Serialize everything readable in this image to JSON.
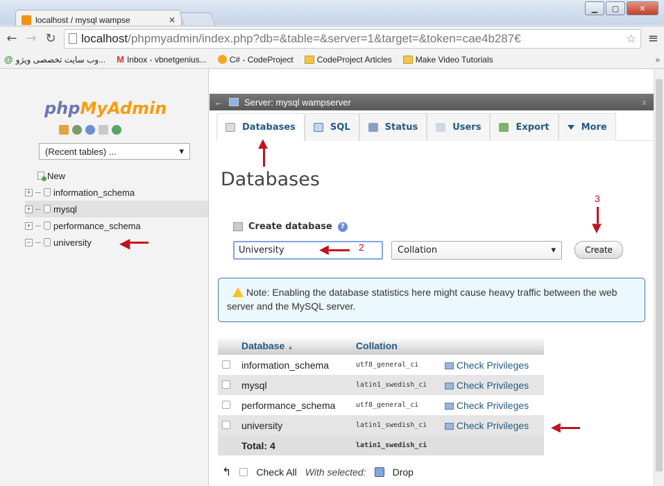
{
  "browser": {
    "tab_title": "localhost / mysql wampse",
    "tab_close": "✕",
    "url_host": "localhost",
    "url_path": "/phpmyadmin/index.php?db=&table=&server=1&target=&token=cae4b287€",
    "bookmarks": [
      {
        "label": "وب سایت تخصصی ویژو...",
        "icon": "ie-icon"
      },
      {
        "label": "Inbox - vbnetgenius...",
        "icon": "gmail-icon"
      },
      {
        "label": "C# - CodeProject",
        "icon": "codeproject-icon"
      },
      {
        "label": "CodeProject Articles",
        "icon": "folder-icon"
      },
      {
        "label": "Make Video Tutorials",
        "icon": "folder-icon"
      }
    ],
    "bookmarks_more": "»"
  },
  "nav": {
    "logo_php": "php",
    "logo_myadmin": "MyAdmin",
    "recent_tables": "(Recent tables) ...",
    "tree": [
      {
        "label": "New",
        "type": "new"
      },
      {
        "label": "information_schema",
        "type": "db"
      },
      {
        "label": "mysql",
        "type": "db"
      },
      {
        "label": "performance_schema",
        "type": "db"
      },
      {
        "label": "university",
        "type": "db"
      }
    ]
  },
  "main": {
    "server_title": "Server: mysql wampserver",
    "tabs": [
      {
        "label": "Databases"
      },
      {
        "label": "SQL"
      },
      {
        "label": "Status"
      },
      {
        "label": "Users"
      },
      {
        "label": "Export"
      },
      {
        "label": "More"
      }
    ],
    "page_title": "Databases",
    "create_label": "Create database",
    "db_name_value": "University",
    "collation_placeholder": "Collation",
    "create_button": "Create",
    "notice": "Note: Enabling the database statistics here might cause heavy traffic between the web server and the MySQL server.",
    "table": {
      "headers": [
        "Database",
        "Collation"
      ],
      "rows": [
        {
          "name": "information_schema",
          "collation": "utf8_general_ci",
          "action": "Check Privileges"
        },
        {
          "name": "mysql",
          "collation": "latin1_swedish_ci",
          "action": "Check Privileges"
        },
        {
          "name": "performance_schema",
          "collation": "utf8_general_ci",
          "action": "Check Privileges"
        },
        {
          "name": "university",
          "collation": "latin1_swedish_ci",
          "action": "Check Privileges"
        }
      ],
      "total_label": "Total: 4",
      "total_collation": "latin1_swedish_ci"
    },
    "check_all": "Check All",
    "with_selected": "With selected:",
    "drop": "Drop"
  },
  "annotations": {
    "step2": "2",
    "step3": "3"
  },
  "colors": {
    "accent_link": "#235a81",
    "annotation_red": "#c1121f",
    "logo_blue": "#6c78af",
    "logo_orange": "#f89c0e"
  }
}
